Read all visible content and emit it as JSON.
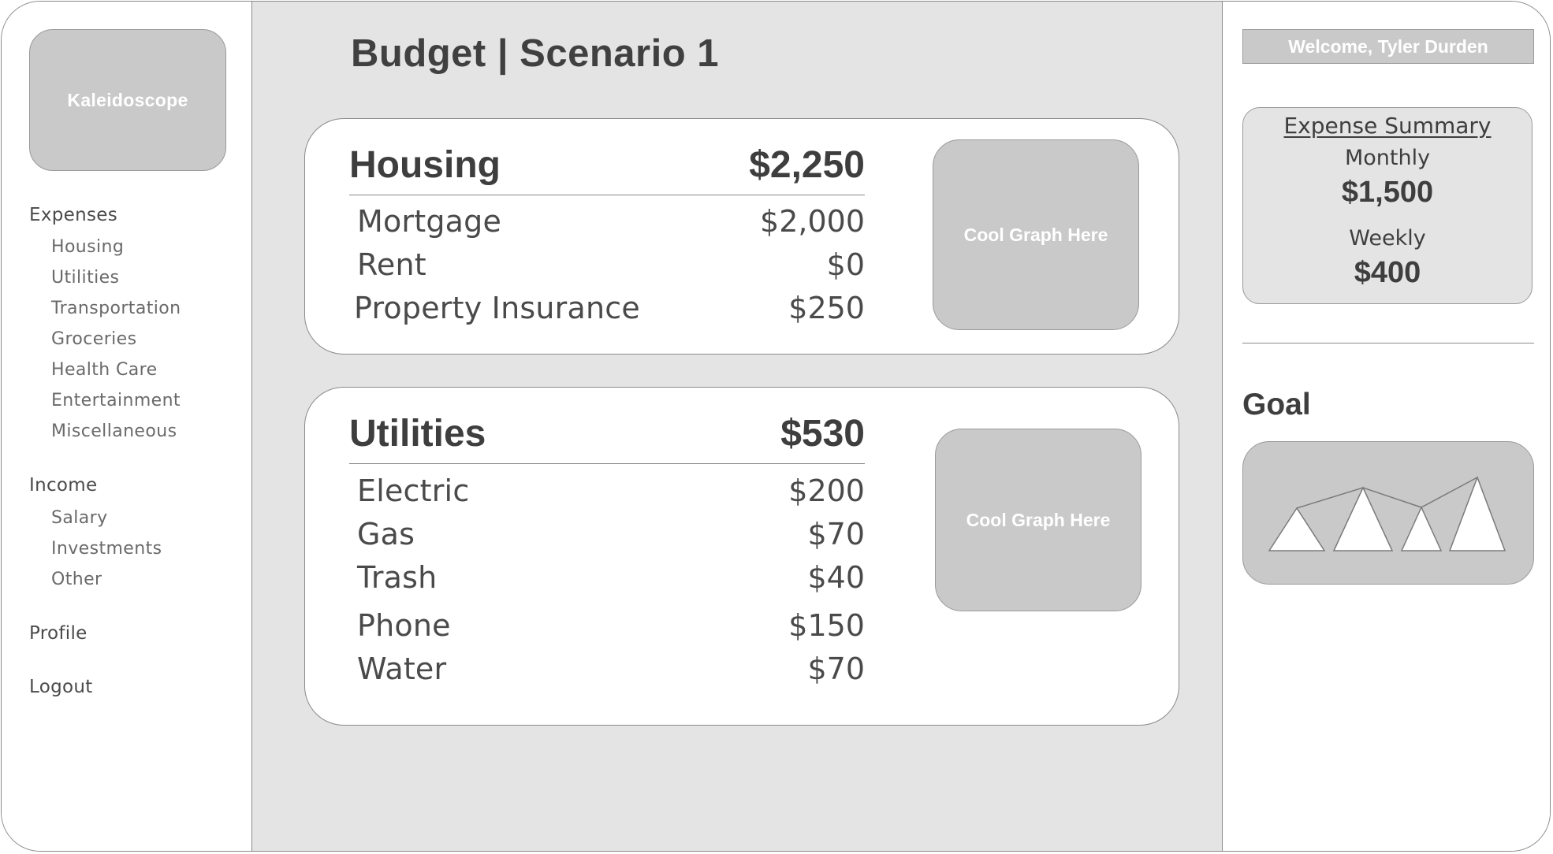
{
  "sidebar": {
    "logo": "Kaleidoscope",
    "expenses": {
      "label": "Expenses",
      "items": [
        "Housing",
        "Utilities",
        "Transportation",
        "Groceries",
        "Health Care",
        "Entertainment",
        "Miscellaneous"
      ]
    },
    "income": {
      "label": "Income",
      "items": [
        "Salary",
        "Investments",
        "Other"
      ]
    },
    "profile": "Profile",
    "logout": "Logout"
  },
  "main": {
    "title": "Budget | Scenario 1",
    "cards": [
      {
        "title": "Housing",
        "total": "$2,250",
        "graph_label": "Cool Graph Here",
        "rows": [
          {
            "label": "Mortgage",
            "value": "$2,000"
          },
          {
            "label": "Rent",
            "value": "$0"
          },
          {
            "label": "Property Insurance",
            "value": "$250"
          }
        ]
      },
      {
        "title": "Utilities",
        "total": "$530",
        "graph_label": "Cool Graph Here",
        "rows": [
          {
            "label": "Electric",
            "value": "$200"
          },
          {
            "label": "Gas",
            "value": "$70"
          },
          {
            "label": "Trash",
            "value": "$40"
          },
          {
            "label": "Phone",
            "value": "$150"
          },
          {
            "label": "Water",
            "value": "$70"
          }
        ]
      }
    ]
  },
  "right": {
    "welcome": "Welcome, Tyler Durden",
    "summary": {
      "title": "Expense Summary",
      "monthly_label": "Monthly",
      "monthly_value": "$1,500",
      "weekly_label": "Weekly",
      "weekly_value": "$400"
    },
    "goal_title": "Goal"
  },
  "colors": {
    "main_bg": "#e4e4e4",
    "placeholder_fill": "#c9c9c9",
    "border": "#8a8a8a",
    "text": "#3e3e3e"
  }
}
